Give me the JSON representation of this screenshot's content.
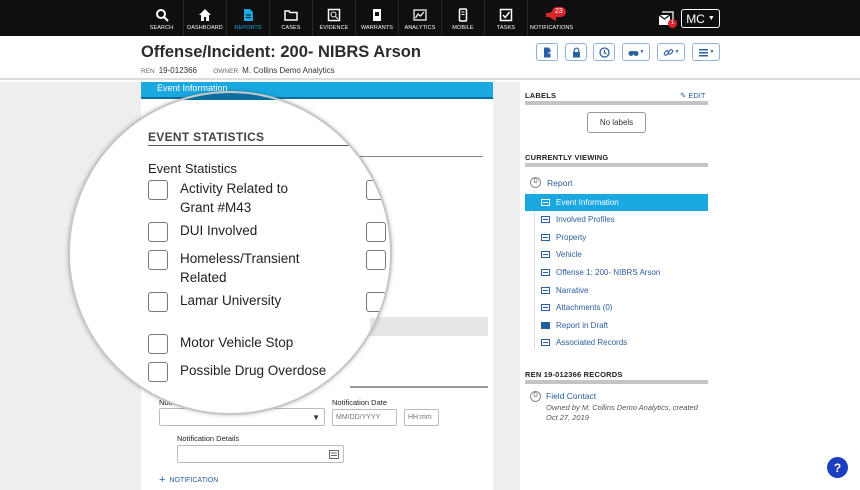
{
  "nav": {
    "items": [
      {
        "label": "SEARCH",
        "icon": "search-icon",
        "active": false
      },
      {
        "label": "DASHBOARD",
        "icon": "home-icon",
        "active": false
      },
      {
        "label": "REPORTS",
        "icon": "report-icon",
        "active": true
      },
      {
        "label": "CASES",
        "icon": "folder-icon",
        "active": false
      },
      {
        "label": "EVIDENCE",
        "icon": "evidence-icon",
        "active": false
      },
      {
        "label": "WARRANTS",
        "icon": "warrant-icon",
        "active": false
      },
      {
        "label": "ANALYTICS",
        "icon": "analytics-icon",
        "active": false
      },
      {
        "label": "MOBILE",
        "icon": "mobile-icon",
        "active": false
      },
      {
        "label": "TASKS",
        "icon": "tasks-icon",
        "active": false
      },
      {
        "label": "NOTIFICATIONS",
        "icon": "megaphone-icon",
        "active": false
      }
    ],
    "notifications_count": "23",
    "inbox_count": "1",
    "user_initials": "MC"
  },
  "header": {
    "title": "Offense/Incident: 200- NIBRS Arson",
    "ren_key": "REN",
    "ren_value": "19-012366",
    "owner_key": "OWNER",
    "owner_value": "M. Collins Demo Analytics"
  },
  "form": {
    "section_bar": "Event Information",
    "section_title": "EVENT STATISTICS",
    "group_label": "Event Statistics",
    "checkboxes": [
      {
        "label_line1": "Activity Related to",
        "label_line2": "Grant #M43",
        "checked": false
      },
      {
        "label_line1": "DUI Involved",
        "label_line2": "",
        "checked": false
      },
      {
        "label_line1": "Homeless/Transient",
        "label_line2": "Related",
        "checked": false
      },
      {
        "label_line1": "Lamar University",
        "label_line2": "",
        "checked": false
      },
      {
        "label_line1": "Motor Vehicle Stop",
        "label_line2": "",
        "checked": false
      },
      {
        "label_line1": "Possible Drug Overdose",
        "label_line2": "",
        "checked": false
      }
    ],
    "notification_type_label": "Noti",
    "notification_date_label": "Notification Date",
    "date_placeholder": "MM/DD/YYYY",
    "time_placeholder": "HH:mm",
    "notification_details_label": "Notification Details",
    "add_notification": "NOTIFICATION"
  },
  "right": {
    "labels_heading": "LABELS",
    "edit": "EDIT",
    "no_labels": "No labels",
    "currently_viewing": "CURRENTLY VIEWING",
    "root_badge": "D",
    "root_label": "Report",
    "items": [
      {
        "label": "Event Information",
        "active": true
      },
      {
        "label": "Involved Profiles",
        "active": false
      },
      {
        "label": "Property",
        "active": false
      },
      {
        "label": "Vehicle",
        "active": false
      },
      {
        "label": "Offense 1: 200- NIBRS Arson",
        "active": false
      },
      {
        "label": "Narrative",
        "active": false
      },
      {
        "label": "Attachments (0)",
        "active": false
      },
      {
        "label": "Report in Draft",
        "active": false
      },
      {
        "label": "Associated Records",
        "active": false
      }
    ],
    "records_heading": "REN 19-012366 RECORDS",
    "record_badge": "D",
    "record_title": "Field Contact",
    "record_meta_line1": "Owned by M. Collins Demo Analytics, created",
    "record_meta_line2": "Oct 27, 2019"
  },
  "help": "?",
  "colors": {
    "accent": "#1aa8e0",
    "link": "#2a5fa0",
    "nav_bg": "#0f0f0f",
    "badge": "#d9262c",
    "help": "#1c3fbf"
  }
}
